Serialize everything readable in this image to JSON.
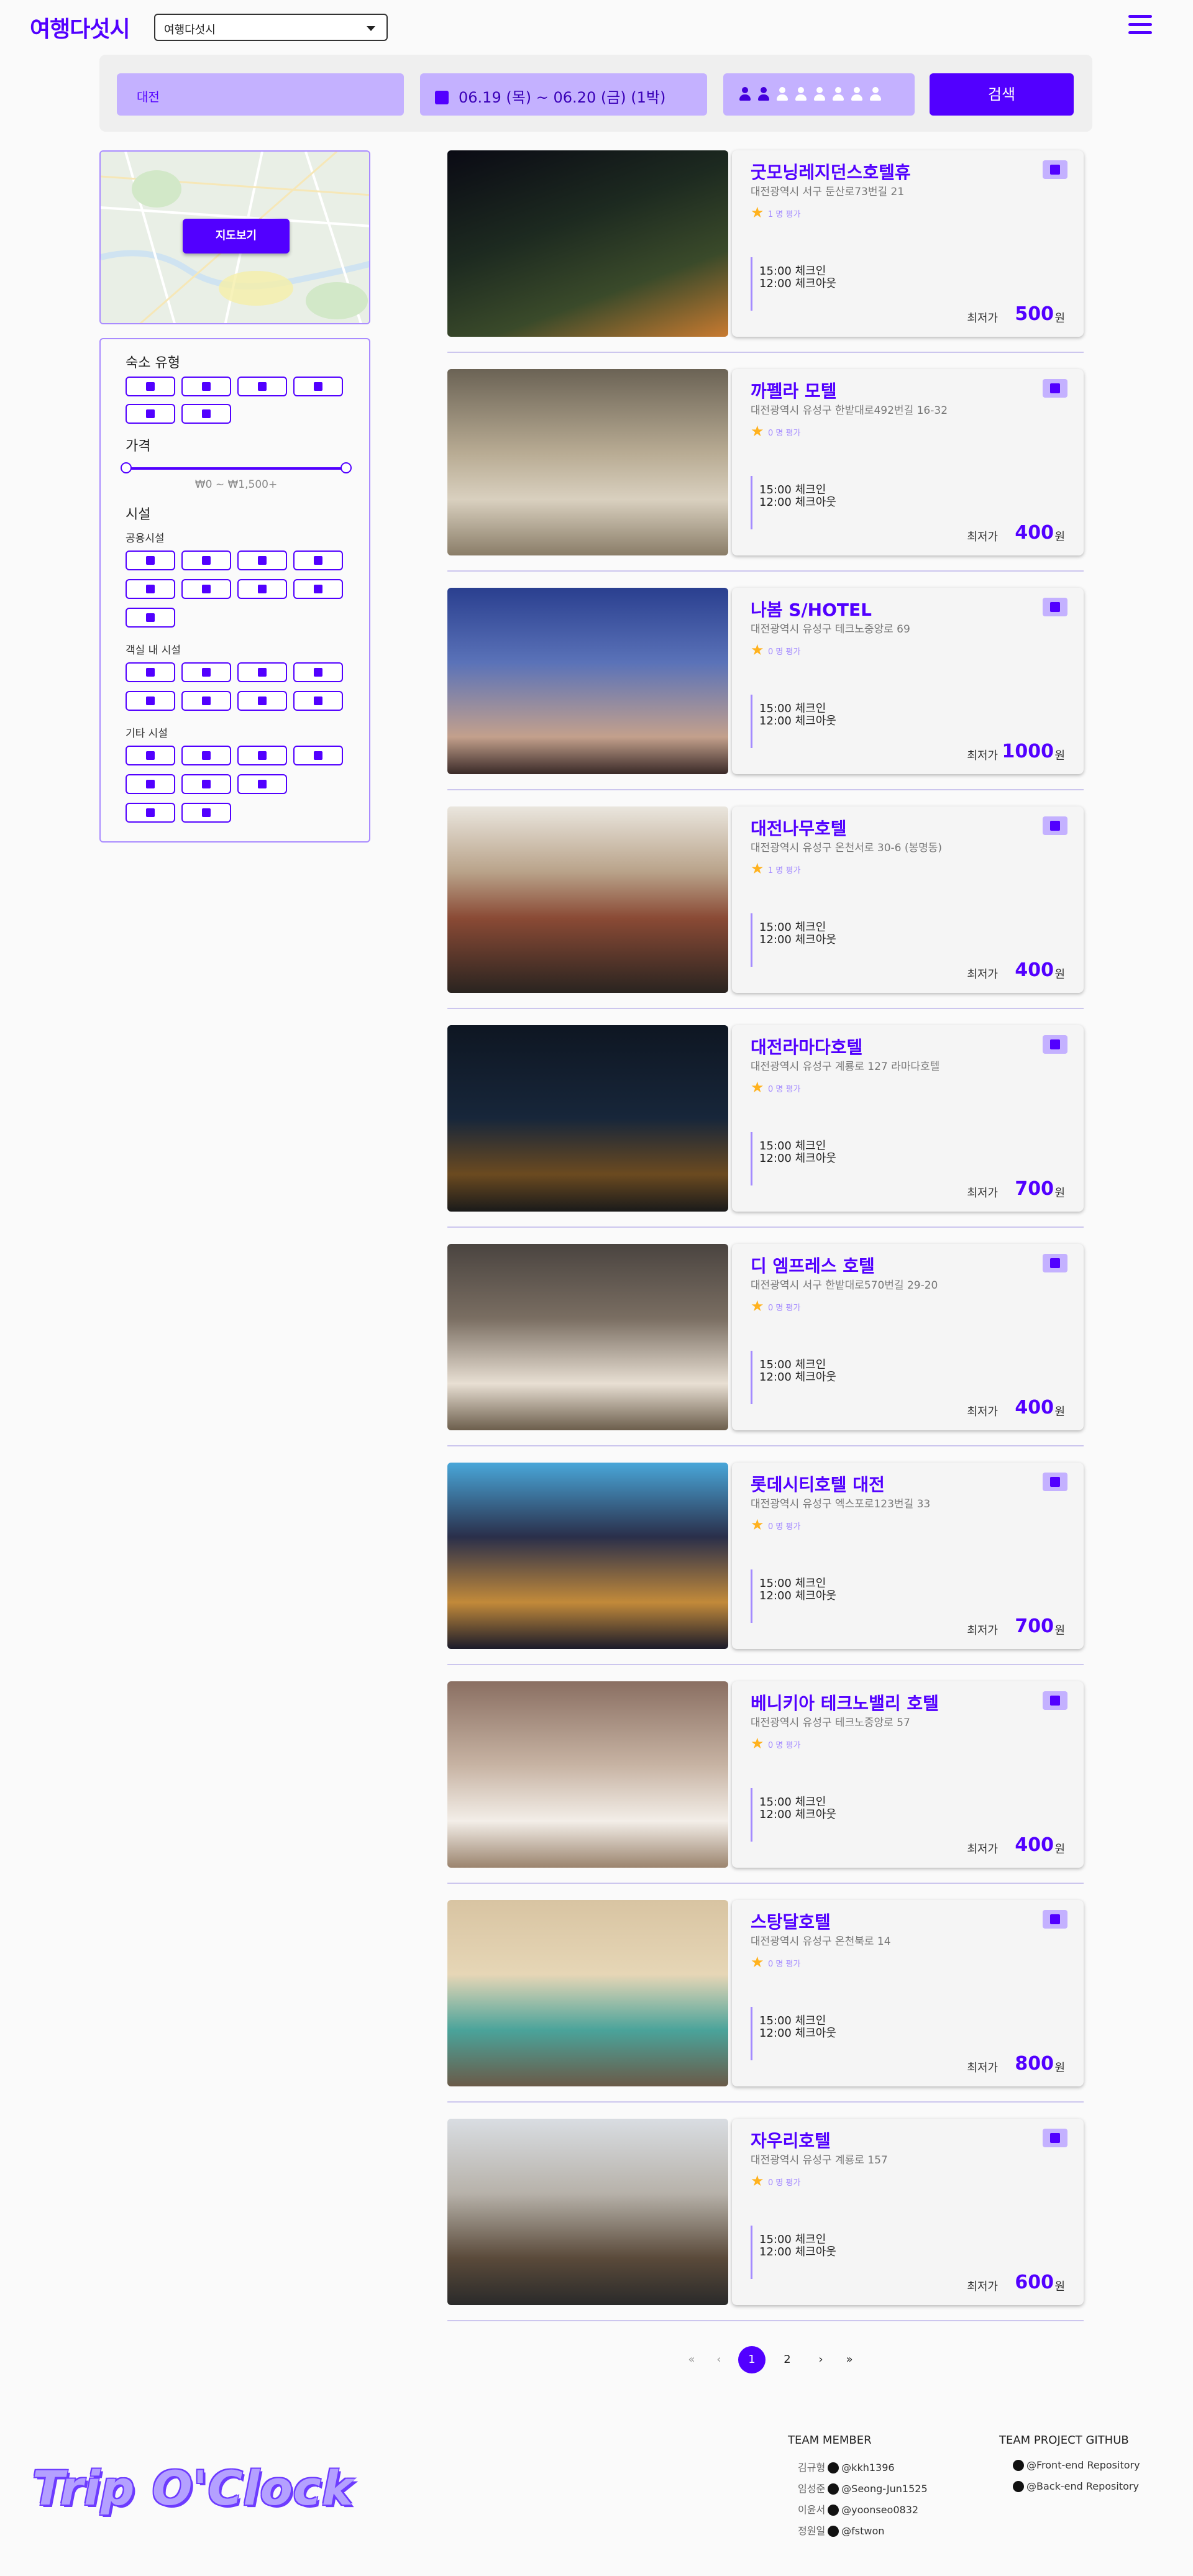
{
  "header": {
    "logo": "여행다섯시",
    "lang_select": "여행다섯시"
  },
  "search": {
    "location": "대전",
    "dates": "06.19 (목) ~ 06.20 (금) (1박)",
    "guests_selected": 2,
    "guests_max": 8,
    "button": "검색"
  },
  "map": {
    "button": "지도보기"
  },
  "filters": {
    "lodging_type": "숙소 유형",
    "price": "가격",
    "price_range": "₩0 ~ ₩1,500+",
    "facilities": "시설",
    "public": "공용시설",
    "in_room": "객실 내 시설",
    "other": "기타 시설"
  },
  "listing_common": {
    "checkin": "15:00 체크인",
    "checkout": "12:00 체크아웃",
    "min_label": "최저가",
    "won": "원"
  },
  "listings": [
    {
      "name": "굿모닝레지던스호텔휴",
      "address": "대전광역시 서구 둔산로73번길 21",
      "rating": "1 명 평가",
      "price": "500"
    },
    {
      "name": "까펠라 모텔",
      "address": "대전광역시 유성구 한밭대로492번길 16-32",
      "rating": "0 명 평가",
      "price": "400"
    },
    {
      "name": "나봄 S/HOTEL",
      "address": "대전광역시 유성구 테크노중앙로 69",
      "rating": "0 명 평가",
      "price": "1000"
    },
    {
      "name": "대전나무호텔",
      "address": "대전광역시 유성구 온천서로 30-6 (봉명동)",
      "rating": "1 명 평가",
      "price": "400"
    },
    {
      "name": "대전라마다호텔",
      "address": "대전광역시 유성구 계룡로 127 라마다호텔",
      "rating": "0 명 평가",
      "price": "700"
    },
    {
      "name": "디 엠프레스 호텔",
      "address": "대전광역시 서구 한밭대로570번길 29-20",
      "rating": "0 명 평가",
      "price": "400"
    },
    {
      "name": "롯데시티호텔 대전",
      "address": "대전광역시 유성구 엑스포로123번길 33",
      "rating": "0 명 평가",
      "price": "700"
    },
    {
      "name": "베니키아 테크노밸리 호텔",
      "address": "대전광역시 유성구 테크노중앙로 57",
      "rating": "0 명 평가",
      "price": "400"
    },
    {
      "name": "스탕달호텔",
      "address": "대전광역시 유성구 온천북로 14",
      "rating": "0 명 평가",
      "price": "800"
    },
    {
      "name": "자우리호텔",
      "address": "대전광역시 유성구 계룡로 157",
      "rating": "0 명 평가",
      "price": "600"
    }
  ],
  "pagination": {
    "first": "«",
    "prev": "‹",
    "page1": "1",
    "page2": "2",
    "next": "›",
    "last": "»"
  },
  "footer": {
    "brand": "Trip O'Clock",
    "team_member": "TEAM MEMBER",
    "team_github": "TEAM PROJECT GITHUB",
    "members": [
      {
        "name": "김규형",
        "handle": "@kkh1396"
      },
      {
        "name": "임성준",
        "handle": "@Seong-Jun1525"
      },
      {
        "name": "이윤서",
        "handle": "@yoonseo0832"
      },
      {
        "name": "정원일",
        "handle": "@fstwon"
      }
    ],
    "repos": [
      "@Front-end Repository",
      "@Back-end Repository"
    ]
  },
  "colors": {
    "accent": "#5200ff",
    "accent_light": "#c4b1ff",
    "star": "#ffb21e"
  }
}
